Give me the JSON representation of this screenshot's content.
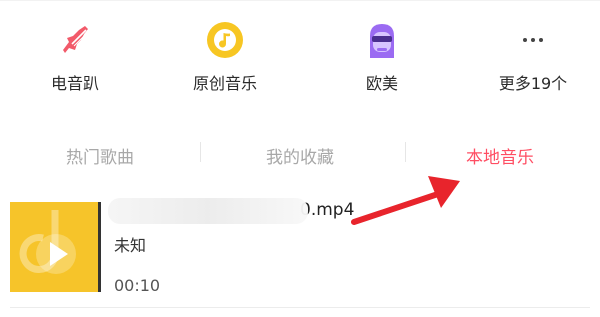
{
  "categories": [
    {
      "label": "电音趴",
      "icon": "electric-guitar-icon",
      "color": "#f25a6a"
    },
    {
      "label": "原创音乐",
      "icon": "music-note-circle-icon",
      "color": "#f7c623"
    },
    {
      "label": "欧美",
      "icon": "sunglasses-avatar-icon",
      "color": "#9b6bf2"
    },
    {
      "label": "更多19个",
      "icon": "more-dots-icon",
      "color": "#555555"
    }
  ],
  "tabs": [
    {
      "label": "热门歌曲",
      "active": false
    },
    {
      "label": "我的收藏",
      "active": false
    },
    {
      "label": "本地音乐",
      "active": true
    }
  ],
  "song": {
    "title_visible": "0.mp4",
    "title_tail": "0",
    "artist": "未知",
    "duration": "00:10",
    "cover_icon": "play-icon"
  },
  "annotation": {
    "type": "arrow",
    "color": "#e8242c"
  },
  "colors": {
    "accent": "#ff4e63",
    "tab_inactive": "#a8a8a8",
    "cover": "#f6c42a"
  }
}
